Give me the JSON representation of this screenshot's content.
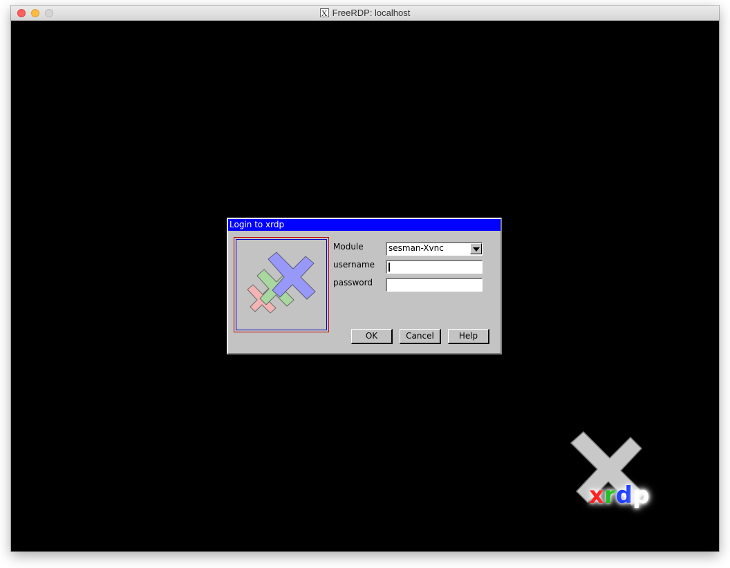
{
  "window": {
    "title": "FreeRDP: localhost"
  },
  "dialog": {
    "title": "Login to xrdp",
    "module": {
      "label": "Module",
      "value": "sesman-Xvnc"
    },
    "username": {
      "label": "username",
      "value": ""
    },
    "password": {
      "label": "password",
      "value": ""
    },
    "buttons": {
      "ok": "OK",
      "cancel": "Cancel",
      "help": "Help"
    }
  },
  "brand": {
    "x": "x",
    "r": "r",
    "d": "d",
    "p": "p"
  },
  "colors": {
    "title_bar": "#0000ff",
    "dialog_bg": "#c3c3c3",
    "desktop": "#000000",
    "x_red": "#ff2020",
    "r_green": "#20c020",
    "d_blue": "#2040ff",
    "p_white": "#ffffff"
  },
  "icons": [
    "close-window-icon",
    "minimize-window-icon",
    "zoom-window-icon",
    "x11-app-icon",
    "xrdp-logo-icon",
    "dropdown-arrow-icon",
    "xrdp-corner-logo-icon"
  ]
}
